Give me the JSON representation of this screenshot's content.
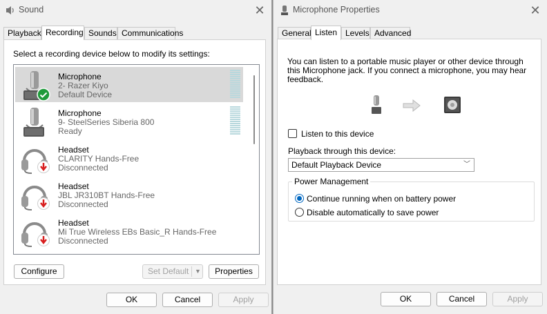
{
  "sound": {
    "title": "Sound",
    "tabs": [
      "Playback",
      "Recording",
      "Sounds",
      "Communications"
    ],
    "active_tab": "Recording",
    "instruction": "Select a recording device below to modify its settings:",
    "devices": [
      {
        "name": "Microphone",
        "detail": "2- Razer Kiyo",
        "status": "Default Device",
        "icon": "microphone-icon",
        "badge": "default-check-icon"
      },
      {
        "name": "Microphone",
        "detail": "9- SteelSeries Siberia 800",
        "status": "Ready",
        "icon": "microphone-icon",
        "badge": ""
      },
      {
        "name": "Headset",
        "detail": "CLARITY Hands-Free",
        "status": "Disconnected",
        "icon": "headset-icon",
        "badge": "disconnected-arrow-icon"
      },
      {
        "name": "Headset",
        "detail": "JBL JR310BT Hands-Free",
        "status": "Disconnected",
        "icon": "headset-icon",
        "badge": "disconnected-arrow-icon"
      },
      {
        "name": "Headset",
        "detail": "Mi True Wireless EBs Basic_R Hands-Free",
        "status": "Disconnected",
        "icon": "headset-icon",
        "badge": "disconnected-arrow-icon"
      }
    ],
    "configure_label": "Configure",
    "set_default_label": "Set Default",
    "properties_label": "Properties",
    "ok_label": "OK",
    "cancel_label": "Cancel",
    "apply_label": "Apply"
  },
  "mic": {
    "title": "Microphone Properties",
    "tabs": [
      "General",
      "Listen",
      "Levels",
      "Advanced"
    ],
    "active_tab": "Listen",
    "description": [
      "You can listen to a portable music player or other device through",
      "this Microphone jack.  If you connect a microphone, you may hear",
      "feedback."
    ],
    "listen_label": "Listen to this device",
    "listen_checked": false,
    "playback_label": "Playback through this device:",
    "playback_value": "Default Playback Device",
    "power_group_label": "Power Management",
    "power_options": [
      "Continue running when on battery power",
      "Disable automatically to save power"
    ],
    "power_selected": 0,
    "ok_label": "OK",
    "cancel_label": "Cancel",
    "apply_label": "Apply"
  },
  "colors": {
    "accent": "#0067c0",
    "check_badge": "#1e9a3a",
    "disconnect_badge": "#d81e1e"
  }
}
